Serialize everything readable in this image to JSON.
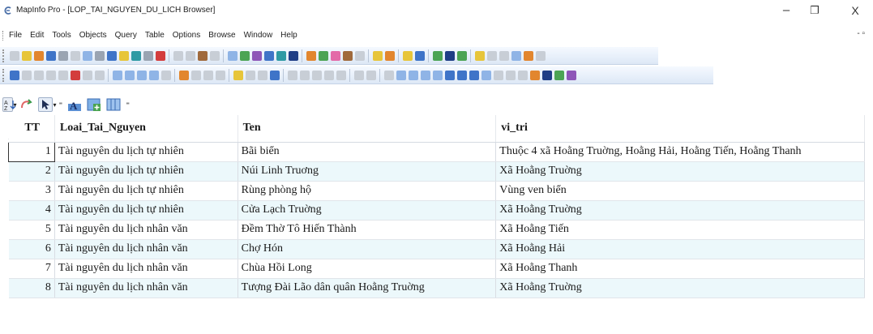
{
  "window": {
    "title": "MapInfo Pro - [LOP_TAI_NGUYEN_DU_LICH Browser]",
    "min_glyph": "–",
    "max_glyph": "❐",
    "close_glyph": "X",
    "doc_controls": "- ▫"
  },
  "menu": {
    "items": [
      "File",
      "Edit",
      "Tools",
      "Objects",
      "Query",
      "Table",
      "Options",
      "Browse",
      "Window",
      "Help"
    ]
  },
  "toolbar3": {
    "dropdown_glyph": "▾",
    "overflow_glyph": "⁼"
  },
  "table": {
    "columns": [
      "TT",
      "Loai_Tai_Nguyen",
      "Ten",
      "vi_tri"
    ],
    "rows": [
      [
        "1",
        "Tài nguyên du lịch tự nhiên",
        "Bãi biển",
        "Thuộc 4 xã Hoằng Truờng, Hoằng Hải, Hoằng Tiến, Hoằng Thanh"
      ],
      [
        "2",
        "Tài nguyên du lịch tự nhiên",
        "Núi Linh Truơng",
        "Xã Hoằng Truờng"
      ],
      [
        "3",
        "Tài nguyên du lịch tự nhiên",
        "Rùng phòng hộ",
        "Vùng ven biển"
      ],
      [
        "4",
        "Tài nguyên du lịch tự nhiên",
        "Cửa Lạch Truờng",
        "Xã Hoằng Truờng"
      ],
      [
        "5",
        "Tài nguyên du lịch nhân văn",
        "Đềm Thờ Tô Hiến Thành",
        "Xã Hoằng Tiến"
      ],
      [
        "6",
        "Tài nguyên du lịch nhân văn",
        "Chợ Hón",
        "Xã Hoằng Hải"
      ],
      [
        "7",
        "Tài nguyên du lịch nhân văn",
        "Chùa Hồi Long",
        "Xã Hoằng Thanh"
      ],
      [
        "8",
        "Tài nguyên du lịch nhân văn",
        "Tượng Đài Lão dân quân Hoằng Truờng",
        "Xã Hoằng Truờng"
      ]
    ]
  },
  "icons": {
    "app": "mapinfo-logo-icon",
    "toolbar3": [
      "sort-icon",
      "refresh-icon",
      "select-arrow-icon",
      "label-icon",
      "add-row-icon",
      "columns-icon"
    ]
  },
  "colors": {
    "row_alt": "#ecf8fb",
    "toolbar_bg": "#dde8f6",
    "grid_line": "#d9dde3"
  }
}
